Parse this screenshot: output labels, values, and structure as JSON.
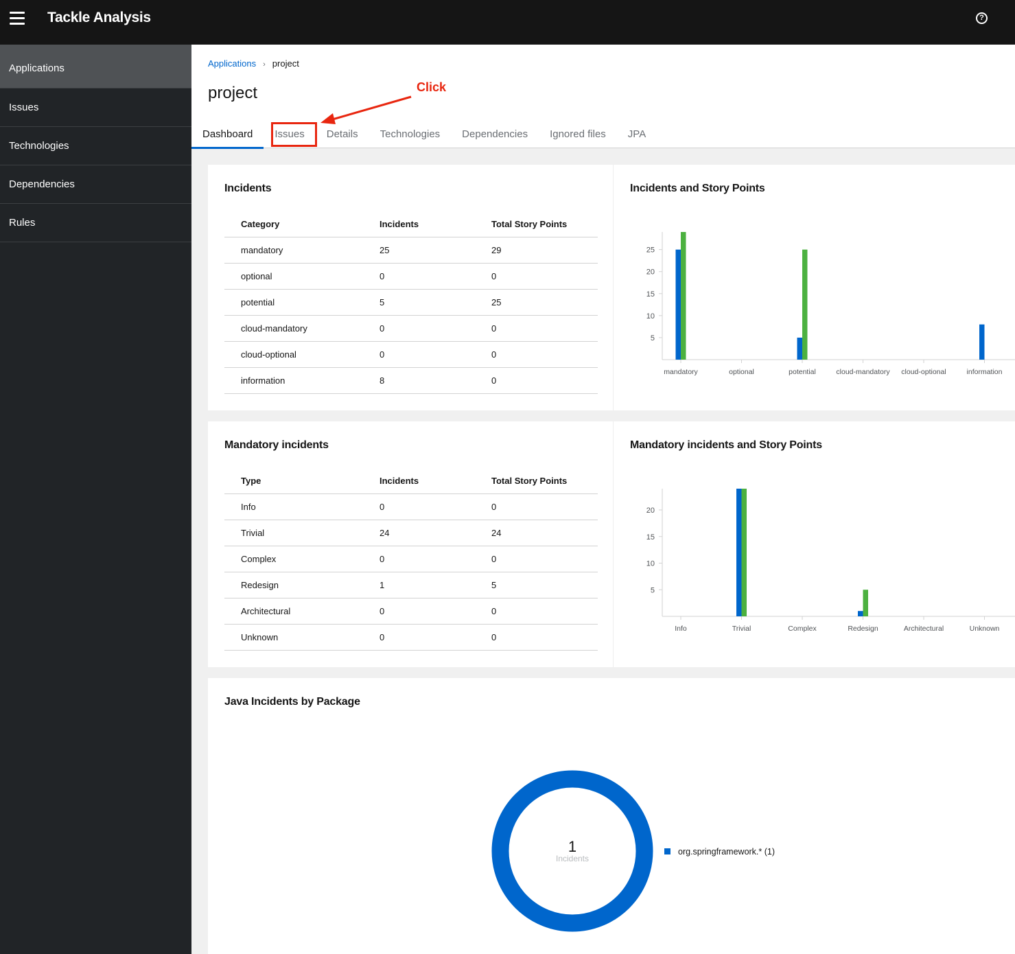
{
  "masthead": {
    "title": "Tackle Analysis",
    "menu_icon": "hamburger-icon",
    "help_icon": "question-circle-icon",
    "help_glyph": "?"
  },
  "sidebar": {
    "items": [
      {
        "label": "Applications",
        "active": true
      },
      {
        "label": "Issues"
      },
      {
        "label": "Technologies"
      },
      {
        "label": "Dependencies"
      },
      {
        "label": "Rules"
      }
    ]
  },
  "breadcrumb": {
    "parent": "Applications",
    "separator": "›",
    "current": "project"
  },
  "page": {
    "title": "project"
  },
  "tabs": [
    {
      "label": "Dashboard",
      "active": true
    },
    {
      "label": "Issues"
    },
    {
      "label": "Details"
    },
    {
      "label": "Technologies"
    },
    {
      "label": "Dependencies"
    },
    {
      "label": "Ignored files"
    },
    {
      "label": "JPA"
    }
  ],
  "annotation": {
    "text": "Click",
    "target": "Issues",
    "color": "#e8260f"
  },
  "colors": {
    "incidents": "#0066cc",
    "story_points": "#4cb140",
    "accent": "#0066cc"
  },
  "incidents_table": {
    "title": "Incidents",
    "headers": [
      "Category",
      "Incidents",
      "Total Story Points"
    ],
    "rows": [
      [
        "mandatory",
        "25",
        "29"
      ],
      [
        "optional",
        "0",
        "0"
      ],
      [
        "potential",
        "5",
        "25"
      ],
      [
        "cloud-mandatory",
        "0",
        "0"
      ],
      [
        "cloud-optional",
        "0",
        "0"
      ],
      [
        "information",
        "8",
        "0"
      ]
    ]
  },
  "mandatory_table": {
    "title": "Mandatory incidents",
    "headers": [
      "Type",
      "Incidents",
      "Total Story Points"
    ],
    "rows": [
      [
        "Info",
        "0",
        "0"
      ],
      [
        "Trivial",
        "24",
        "24"
      ],
      [
        "Complex",
        "0",
        "0"
      ],
      [
        "Redesign",
        "1",
        "5"
      ],
      [
        "Architectural",
        "0",
        "0"
      ],
      [
        "Unknown",
        "0",
        "0"
      ]
    ]
  },
  "chart_data": [
    {
      "type": "bar",
      "title": "Incidents and Story Points",
      "categories": [
        "mandatory",
        "optional",
        "potential",
        "cloud-mandatory",
        "cloud-optional",
        "information"
      ],
      "series": [
        {
          "name": "Incidents",
          "values": [
            25,
            0,
            5,
            0,
            0,
            8
          ]
        },
        {
          "name": "Total Story Points",
          "values": [
            29,
            0,
            25,
            0,
            0,
            0
          ]
        }
      ],
      "yticks": [
        5,
        10,
        15,
        20,
        25
      ],
      "ylim": [
        0,
        29
      ],
      "xlabel": "",
      "ylabel": "",
      "grid": false
    },
    {
      "type": "bar",
      "title": "Mandatory incidents and Story Points",
      "categories": [
        "Info",
        "Trivial",
        "Complex",
        "Redesign",
        "Architectural",
        "Unknown"
      ],
      "series": [
        {
          "name": "Incidents",
          "values": [
            0,
            24,
            0,
            1,
            0,
            0
          ]
        },
        {
          "name": "Total Story Points",
          "values": [
            0,
            24,
            0,
            5,
            0,
            0
          ]
        }
      ],
      "yticks": [
        5,
        10,
        15,
        20
      ],
      "ylim": [
        0,
        24
      ],
      "xlabel": "",
      "ylabel": "",
      "grid": false
    },
    {
      "type": "pie",
      "title": "Java Incidents by Package",
      "donut": true,
      "center_value": "1",
      "center_label": "Incidents",
      "slices": [
        {
          "label": "org.springframework.*",
          "value": 1,
          "legend": "org.springframework.* (1)"
        }
      ],
      "legend_position": "right"
    }
  ]
}
